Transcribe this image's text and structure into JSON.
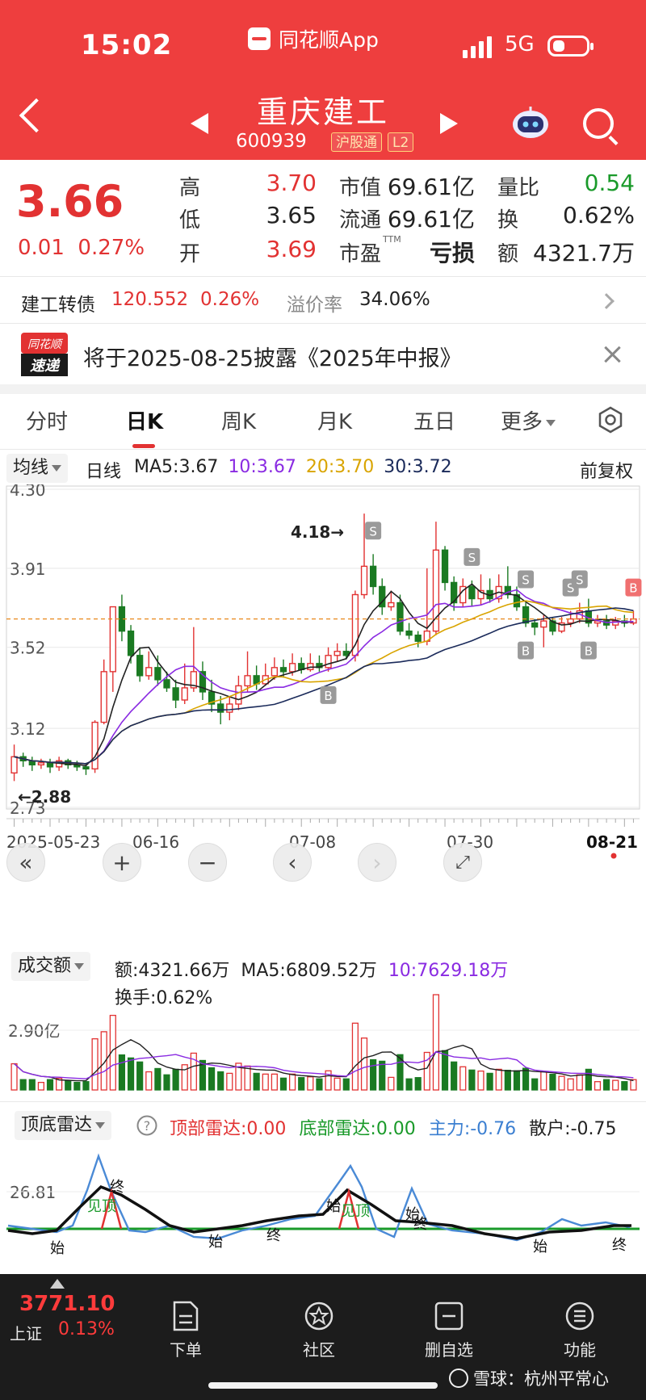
{
  "status_bar": {
    "time": "15:02",
    "app_name": "同花顺App",
    "network": "5G"
  },
  "header": {
    "name": "重庆建工",
    "code": "600939",
    "tags": [
      "沪股通",
      "L2"
    ]
  },
  "quote": {
    "price": "3.66",
    "change": "0.01",
    "change_pct": "0.27%",
    "stats": [
      {
        "label": "高",
        "value": "3.70",
        "color": "#e23232"
      },
      {
        "label": "低",
        "value": "3.65",
        "color": "#222222"
      },
      {
        "label": "开",
        "value": "3.69",
        "color": "#e23232"
      },
      {
        "label": "市值",
        "value": "69.61亿",
        "color": "#222222"
      },
      {
        "label": "流通",
        "value": "69.61亿",
        "color": "#222222"
      },
      {
        "label": "市盈",
        "sup": "TTM",
        "value": "亏损",
        "color": "#222222"
      },
      {
        "label": "量比",
        "value": "0.54",
        "color": "#1a9a2a"
      },
      {
        "label": "换",
        "value": "0.62%",
        "color": "#222222"
      },
      {
        "label": "额",
        "value": "4321.7万",
        "color": "#222222"
      }
    ]
  },
  "bond": {
    "name": "建工转债",
    "price": "120.552",
    "change": "0.26%",
    "premium_label": "溢价率",
    "premium": "34.06%"
  },
  "notice": {
    "logo_top": "同花顺",
    "logo_bottom": "速递",
    "text": "将于2025-08-25披露《2025年中报》"
  },
  "tabs": [
    {
      "label": "分时",
      "active": false
    },
    {
      "label": "日K",
      "active": true
    },
    {
      "label": "周K",
      "active": false
    },
    {
      "label": "月K",
      "active": false
    },
    {
      "label": "五日",
      "active": false
    },
    {
      "label": "更多",
      "active": false
    }
  ],
  "kline": {
    "chip": "均线",
    "period": "日线",
    "ma": [
      {
        "label": "MA5:3.67",
        "color": "#222222"
      },
      {
        "label": "10:3.67",
        "color": "#8a2be2"
      },
      {
        "label": "20:3.70",
        "color": "#d9a400"
      },
      {
        "label": "30:3.72",
        "color": "#1a2a5a"
      }
    ],
    "adjust": "前复权",
    "y_ticks": [
      "4.30",
      "3.91",
      "3.52",
      "3.12",
      "2.73"
    ],
    "high_label": "4.18→",
    "low_label": "←2.88",
    "current_price": 3.66,
    "x_labels": [
      "2025-05-23",
      "06-16",
      "07-08",
      "07-30",
      "08-21"
    ]
  },
  "chart_data": {
    "type": "candlestick",
    "ylim": [
      2.73,
      4.3
    ],
    "x_range": [
      "2025-05-23",
      "2025-08-21"
    ],
    "candles": [
      [
        2.9,
        2.98,
        3.04,
        2.86
      ],
      [
        2.98,
        2.96,
        3.0,
        2.93
      ],
      [
        2.96,
        2.94,
        2.98,
        2.91
      ],
      [
        2.94,
        2.95,
        2.97,
        2.92
      ],
      [
        2.95,
        2.93,
        2.97,
        2.9
      ],
      [
        2.93,
        2.96,
        2.98,
        2.91
      ],
      [
        2.96,
        2.94,
        2.97,
        2.92
      ],
      [
        2.94,
        2.93,
        2.96,
        2.91
      ],
      [
        2.93,
        2.92,
        2.95,
        2.89
      ],
      [
        2.92,
        3.15,
        3.16,
        2.9
      ],
      [
        3.15,
        3.4,
        3.46,
        3.14
      ],
      [
        3.4,
        3.72,
        3.72,
        3.3
      ],
      [
        3.72,
        3.6,
        3.78,
        3.55
      ],
      [
        3.6,
        3.48,
        3.63,
        3.44
      ],
      [
        3.48,
        3.38,
        3.52,
        3.35
      ],
      [
        3.38,
        3.42,
        3.5,
        3.36
      ],
      [
        3.42,
        3.36,
        3.48,
        3.33
      ],
      [
        3.36,
        3.32,
        3.4,
        3.3
      ],
      [
        3.32,
        3.26,
        3.36,
        3.22
      ],
      [
        3.26,
        3.32,
        3.44,
        3.24
      ],
      [
        3.32,
        3.4,
        3.62,
        3.3
      ],
      [
        3.4,
        3.3,
        3.45,
        3.26
      ],
      [
        3.3,
        3.24,
        3.36,
        3.2
      ],
      [
        3.24,
        3.2,
        3.28,
        3.14
      ],
      [
        3.2,
        3.24,
        3.28,
        3.16
      ],
      [
        3.24,
        3.33,
        3.38,
        3.21
      ],
      [
        3.33,
        3.38,
        3.5,
        3.3
      ],
      [
        3.38,
        3.34,
        3.43,
        3.31
      ],
      [
        3.34,
        3.38,
        3.44,
        3.33
      ],
      [
        3.38,
        3.42,
        3.47,
        3.36
      ],
      [
        3.42,
        3.4,
        3.46,
        3.37
      ],
      [
        3.4,
        3.44,
        3.49,
        3.38
      ],
      [
        3.44,
        3.41,
        3.47,
        3.39
      ],
      [
        3.41,
        3.44,
        3.49,
        3.4
      ],
      [
        3.44,
        3.42,
        3.48,
        3.4
      ],
      [
        3.42,
        3.48,
        3.52,
        3.4
      ],
      [
        3.48,
        3.5,
        3.54,
        3.45
      ],
      [
        3.5,
        3.48,
        3.54,
        3.46
      ],
      [
        3.48,
        3.78,
        3.8,
        3.45
      ],
      [
        3.78,
        3.92,
        4.18,
        3.76
      ],
      [
        3.92,
        3.82,
        3.98,
        3.78
      ],
      [
        3.82,
        3.72,
        3.86,
        3.68
      ],
      [
        3.72,
        3.74,
        3.8,
        3.7
      ],
      [
        3.74,
        3.6,
        3.78,
        3.58
      ],
      [
        3.6,
        3.58,
        3.64,
        3.56
      ],
      [
        3.58,
        3.55,
        3.6,
        3.52
      ],
      [
        3.55,
        3.6,
        3.91,
        3.53
      ],
      [
        3.6,
        4.0,
        4.14,
        3.58
      ],
      [
        4.0,
        3.84,
        4.02,
        3.8
      ],
      [
        3.84,
        3.74,
        3.87,
        3.7
      ],
      [
        3.74,
        3.82,
        3.86,
        3.72
      ],
      [
        3.82,
        3.76,
        3.85,
        3.72
      ],
      [
        3.76,
        3.8,
        3.88,
        3.73
      ],
      [
        3.8,
        3.76,
        3.86,
        3.74
      ],
      [
        3.76,
        3.82,
        3.88,
        3.74
      ],
      [
        3.82,
        3.78,
        3.92,
        3.76
      ],
      [
        3.78,
        3.72,
        3.82,
        3.7
      ],
      [
        3.72,
        3.64,
        3.74,
        3.62
      ],
      [
        3.64,
        3.62,
        3.66,
        3.58
      ],
      [
        3.62,
        3.65,
        3.68,
        3.52
      ],
      [
        3.65,
        3.6,
        3.67,
        3.58
      ],
      [
        3.6,
        3.64,
        3.67,
        3.59
      ],
      [
        3.64,
        3.66,
        3.7,
        3.62
      ],
      [
        3.66,
        3.7,
        3.74,
        3.64
      ],
      [
        3.7,
        3.64,
        3.76,
        3.62
      ],
      [
        3.64,
        3.65,
        3.68,
        3.62
      ],
      [
        3.65,
        3.63,
        3.68,
        3.61
      ],
      [
        3.63,
        3.65,
        3.67,
        3.61
      ],
      [
        3.65,
        3.64,
        3.68,
        3.62
      ],
      [
        3.64,
        3.66,
        3.7,
        3.63
      ]
    ]
  },
  "volume": {
    "chip": "成交额",
    "labels": [
      {
        "text": "额:4321.66万",
        "color": "#222222"
      },
      {
        "text": "MA5:6809.52万",
        "color": "#222222"
      },
      {
        "text": "10:7629.18万",
        "color": "#8a2be2"
      }
    ],
    "turnover": "换手:0.62%",
    "y_tick": "2.90亿"
  },
  "radar": {
    "chip": "顶底雷达",
    "help": "?",
    "labels": [
      {
        "text": "顶部雷达:0.00",
        "color": "#e23232"
      },
      {
        "text": "底部雷达:0.00",
        "color": "#1a9a2a"
      },
      {
        "text": "主力:-0.76",
        "color": "#3b7fd1"
      },
      {
        "text": "散户:-0.75",
        "color": "#222222"
      }
    ],
    "y_tick": "26.81",
    "marks": [
      "始",
      "见顶",
      "终",
      "始",
      "终",
      "始",
      "见顶",
      "始",
      "终",
      "始",
      "终"
    ]
  },
  "bottom_nav": {
    "index_value": "3771.10",
    "index_name": "上证",
    "index_change": "0.13%",
    "items": [
      "下单",
      "社区",
      "删自选",
      "功能"
    ]
  },
  "watermark": "雪球：杭州平常心",
  "colors": {
    "header_red": "#ee3e3e",
    "up": "#e23232",
    "down": "#1a7a22"
  }
}
